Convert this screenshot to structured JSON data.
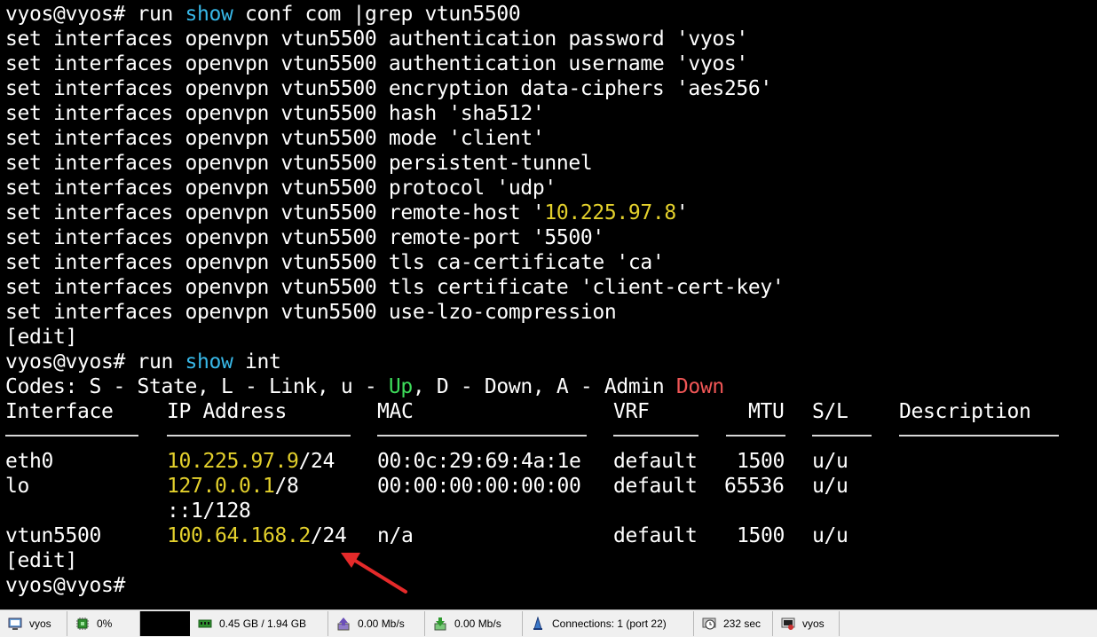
{
  "terminal": {
    "cmd1": {
      "prompt": "vyos@vyos# ",
      "run": "run ",
      "show": "show",
      "rest": " conf com |grep vtun5500"
    },
    "config_lines": [
      {
        "prefix": "set interfaces openvpn vtun5500 authentication password 'vyos'"
      },
      {
        "prefix": "set interfaces openvpn vtun5500 authentication username 'vyos'"
      },
      {
        "prefix": "set interfaces openvpn vtun5500 encryption data-ciphers 'aes256'"
      },
      {
        "prefix": "set interfaces openvpn vtun5500 hash 'sha512'"
      },
      {
        "prefix": "set interfaces openvpn vtun5500 mode 'client'"
      },
      {
        "prefix": "set interfaces openvpn vtun5500 persistent-tunnel"
      },
      {
        "prefix": "set interfaces openvpn vtun5500 protocol 'udp'"
      }
    ],
    "remote_host": {
      "pre": "set interfaces openvpn vtun5500 remote-host '",
      "ip": "10.225.97.8",
      "post": "'"
    },
    "config_lines_2": [
      {
        "prefix": "set interfaces openvpn vtun5500 remote-port '5500'"
      },
      {
        "prefix": "set interfaces openvpn vtun5500 tls ca-certificate 'ca'"
      },
      {
        "prefix": "set interfaces openvpn vtun5500 tls certificate 'client-cert-key'"
      },
      {
        "prefix": "set interfaces openvpn vtun5500 use-lzo-compression"
      }
    ],
    "edit1": "[edit]",
    "cmd2": {
      "prompt": "vyos@vyos# ",
      "run": "run ",
      "show": "show",
      "rest": " int"
    },
    "codes": {
      "pre": "Codes: S - State, L - Link, u - ",
      "up": "Up",
      "mid": ", D - Down, A - Admin ",
      "down": "Down"
    },
    "headers": {
      "interface": "Interface",
      "ip": "IP Address",
      "mac": "MAC",
      "vrf": "VRF",
      "mtu": "MTU",
      "sl": "S/L",
      "desc": "Description"
    },
    "rows": [
      {
        "iface": "eth0",
        "ip": "10.225.97.9",
        "mask": "/24",
        "mac": "00:0c:29:69:4a:1e",
        "vrf": "default",
        "mtu": "1500",
        "sl": "u/u"
      },
      {
        "iface": "lo",
        "ip": "127.0.0.1",
        "mask": "/8",
        "mac": "00:00:00:00:00:00",
        "vrf": "default",
        "mtu": "65536",
        "sl": "u/u"
      },
      {
        "iface": "vtun5500",
        "ip": "100.64.168.2",
        "mask": "/24",
        "mac": "n/a",
        "vrf": "default",
        "mtu": "1500",
        "sl": "u/u"
      }
    ],
    "lo_ipv6": "::1/128",
    "edit2": "[edit]",
    "final_prompt": "vyos@vyos#"
  },
  "statusbar": {
    "session": "vyos",
    "cpu": "0%",
    "memory": "0.45 GB / 1.94 GB",
    "upload": "0.00 Mb/s",
    "download": "0.00 Mb/s",
    "connections": "Connections: 1 (port 22)",
    "uptime": "232 sec",
    "user": "vyos"
  },
  "colors": {
    "command": "#38b8e8",
    "ip": "#e3d02c",
    "up": "#3ddc5a",
    "down": "#f05656",
    "interface_header": "#e74cf0",
    "arrow": "#e52a2a"
  },
  "icons": [
    "session-icon",
    "cpu-icon",
    "memory-icon",
    "upload-icon",
    "download-icon",
    "connections-icon",
    "uptime-icon",
    "user-icon"
  ]
}
